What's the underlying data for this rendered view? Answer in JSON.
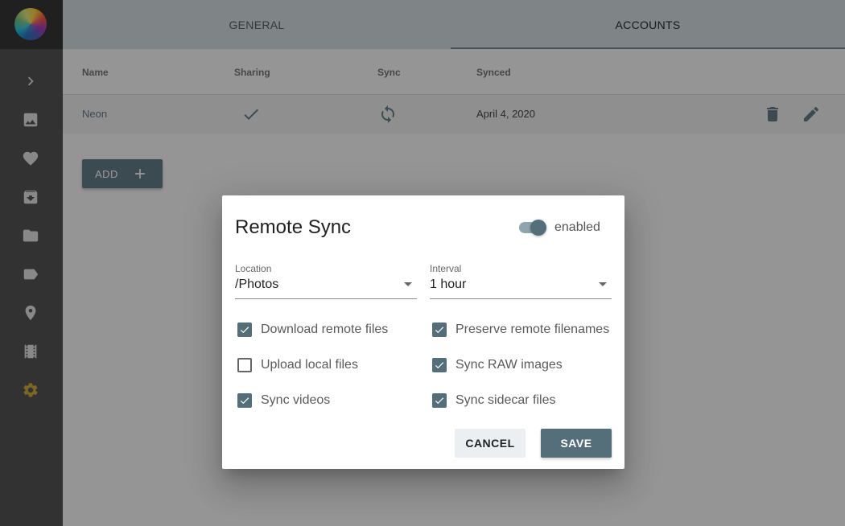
{
  "tabs": [
    {
      "label": "GENERAL"
    },
    {
      "label": "ACCOUNTS"
    }
  ],
  "table": {
    "headers": [
      "Name",
      "Sharing",
      "Sync",
      "Synced"
    ],
    "rows": [
      {
        "name": "Neon",
        "sharing": "check-icon",
        "sync": "sync-icon",
        "synced": "April 4, 2020"
      }
    ]
  },
  "add_button": {
    "label": "ADD"
  },
  "sidebar": {
    "icons": [
      "chevron-right-icon",
      "photo-icon",
      "heart-icon",
      "archive-icon",
      "folder-icon",
      "label-icon",
      "place-icon",
      "movie-icon",
      "settings-icon"
    ]
  },
  "dialog": {
    "title": "Remote Sync",
    "switch_label": "enabled",
    "switch_on": true,
    "location": {
      "label": "Location",
      "value": "/Photos"
    },
    "interval": {
      "label": "Interval",
      "value": "1 hour"
    },
    "options": [
      {
        "label": "Download remote files",
        "checked": true
      },
      {
        "label": "Preserve remote filenames",
        "checked": true
      },
      {
        "label": "Upload local files",
        "checked": false
      },
      {
        "label": "Sync RAW images",
        "checked": true
      },
      {
        "label": "Sync videos",
        "checked": true
      },
      {
        "label": "Sync sidecar files",
        "checked": true
      }
    ],
    "cancel_label": "CANCEL",
    "save_label": "SAVE"
  },
  "colors": {
    "accent": "#546e7a",
    "active_sidebar_icon": "#c9a227",
    "sidebar_bg": "#424242"
  }
}
